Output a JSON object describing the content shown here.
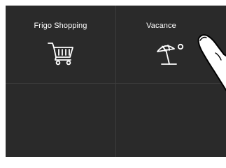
{
  "tiles": [
    {
      "label": "Frigo Shopping",
      "icon": "shopping-cart-icon"
    },
    {
      "label": "Vacance",
      "icon": "beach-umbrella-icon"
    },
    {
      "label": "",
      "icon": ""
    },
    {
      "label": "",
      "icon": ""
    }
  ],
  "colors": {
    "background": "#2a2a2a",
    "divider": "#3e3e3e",
    "text": "#ffffff"
  }
}
